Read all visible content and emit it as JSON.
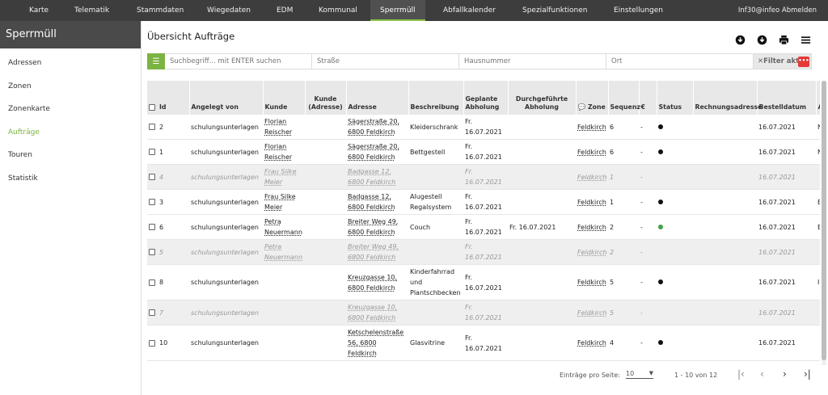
{
  "topnav": {
    "items": [
      "Karte",
      "Telematik",
      "Stammdaten",
      "Wiegedaten",
      "EDM",
      "Kommunal",
      "Sperrmüll",
      "Abfallkalender",
      "Spezialfunktionen",
      "Einstellungen"
    ],
    "active": "Sperrmüll",
    "user": "Inf30@infeo Abmelden"
  },
  "sidebar": {
    "title": "Sperrmüll",
    "items": [
      "Adressen",
      "Zonen",
      "Zonenkarte",
      "Aufträge",
      "Touren",
      "Statistik"
    ],
    "active": "Aufträge"
  },
  "main": {
    "title": "Übersicht Aufträge",
    "icons": [
      "download-icon",
      "download-icon",
      "print-icon",
      "menu-icon"
    ]
  },
  "filter": {
    "search_placeholder": "Suchbegriff... mit ENTER suchen",
    "strasse_placeholder": "Straße",
    "hausnummer_placeholder": "Hausnummer",
    "ort_placeholder": "Ort",
    "filter_label": "Filter akt",
    "badge": "•••"
  },
  "table": {
    "headers": {
      "id": "Id",
      "angelegt": "Angelegt von",
      "kunde": "Kunde",
      "kunde_adresse": "Kunde (Adresse)",
      "adresse": "Adresse",
      "beschreibung": "Beschreibung",
      "geplante": "Geplante Abholung",
      "durchgefuehrte": "Durchgeführte Abholung",
      "zone": "Zone",
      "sequenz": "Sequenz",
      "euro": "€",
      "status": "Status",
      "rechnungsadresse": "Rechnungsadresse",
      "bestelldatum": "Bestelldatum",
      "extra": "A"
    },
    "rows": [
      {
        "id": "2",
        "angelegt": "schulungsunterlagen",
        "kunde": "Florian Reischer",
        "adresse": "Sägerstraße 20, 6800 Feldkirch",
        "beschreibung": "Kleiderschrank",
        "geplante": "Fr. 16.07.2021",
        "durchgefuehrte": "",
        "zone": "Feldkirch",
        "sequenz": "6",
        "euro": "-",
        "status": "black",
        "bestelldatum": "16.07.2021",
        "extra": "N W",
        "muted": false
      },
      {
        "id": "1",
        "angelegt": "schulungsunterlagen",
        "kunde": "Florian Reischer",
        "adresse": "Sägerstraße 20, 6800 Feldkirch",
        "beschreibung": "Bettgestell",
        "geplante": "Fr. 16.07.2021",
        "durchgefuehrte": "",
        "zone": "Feldkirch",
        "sequenz": "6",
        "euro": "-",
        "status": "black",
        "bestelldatum": "16.07.2021",
        "extra": "N W",
        "muted": false
      },
      {
        "id": "4",
        "angelegt": "schulungsunterlagen",
        "kunde": "Frau Silke Meier",
        "adresse": "Badgasse 12, 6800 Feldkirch",
        "beschreibung": "",
        "geplante": "Fr. 16.07.2021",
        "durchgefuehrte": "",
        "zone": "Feldkirch",
        "sequenz": "1",
        "euro": "-",
        "status": "none",
        "bestelldatum": "16.07.2021",
        "extra": "",
        "muted": true
      },
      {
        "id": "3",
        "angelegt": "schulungsunterlagen",
        "kunde": "Frau Silke Meier",
        "adresse": "Badgasse 12, 6800 Feldkirch",
        "beschreibung": "Alugestell Regalsystem",
        "geplante": "Fr. 16.07.2021",
        "durchgefuehrte": "",
        "zone": "Feldkirch",
        "sequenz": "1",
        "euro": "-",
        "status": "black",
        "bestelldatum": "16.07.2021",
        "extra": "E W",
        "muted": false
      },
      {
        "id": "6",
        "angelegt": "schulungsunterlagen",
        "kunde": "Petra Neuermann",
        "adresse": "Breiter Weg 49, 6800 Feldkirch",
        "beschreibung": "Couch",
        "geplante": "Fr. 16.07.2021",
        "durchgefuehrte": "Fr. 16.07.2021",
        "zone": "Feldkirch",
        "sequenz": "2",
        "euro": "-",
        "status": "green",
        "bestelldatum": "16.07.2021",
        "extra": "E W",
        "muted": false
      },
      {
        "id": "5",
        "angelegt": "schulungsunterlagen",
        "kunde": "Petra Neuermann",
        "adresse": "Breiter Weg 49, 6800 Feldkirch",
        "beschreibung": "",
        "geplante": "Fr. 16.07.2021",
        "durchgefuehrte": "",
        "zone": "Feldkirch",
        "sequenz": "2",
        "euro": "-",
        "status": "none",
        "bestelldatum": "16.07.2021",
        "extra": "",
        "muted": true
      },
      {
        "id": "8",
        "angelegt": "schulungsunterlagen",
        "kunde": "",
        "adresse": "Kreuzgasse 10, 6800 Feldkirch",
        "beschreibung": "Kinderfahrrad und Plantschbecken",
        "geplante": "Fr. 16.07.2021",
        "durchgefuehrte": "",
        "zone": "Feldkirch",
        "sequenz": "5",
        "euro": "-",
        "status": "black",
        "bestelldatum": "16.07.2021",
        "extra": "I",
        "muted": false
      },
      {
        "id": "7",
        "angelegt": "schulungsunterlagen",
        "kunde": "",
        "adresse": "Kreuzgasse 10, 6800 Feldkirch",
        "beschreibung": "",
        "geplante": "Fr. 16.07.2021",
        "durchgefuehrte": "",
        "zone": "Feldkirch",
        "sequenz": "5",
        "euro": "-",
        "status": "none",
        "bestelldatum": "16.07.2021",
        "extra": "",
        "muted": true
      },
      {
        "id": "10",
        "angelegt": "schulungsunterlagen",
        "kunde": "",
        "adresse": "Ketschelenstraße 56, 6800 Feldkirch",
        "beschreibung": "Glasvitrine",
        "geplante": "Fr. 16.07.2021",
        "durchgefuehrte": "",
        "zone": "Feldkirch",
        "sequenz": "4",
        "euro": "-",
        "status": "black",
        "bestelldatum": "16.07.2021",
        "extra": "",
        "muted": false
      }
    ]
  },
  "pager": {
    "label": "Einträge pro Seite:",
    "per_page": "10",
    "range": "1 - 10 von 12"
  }
}
